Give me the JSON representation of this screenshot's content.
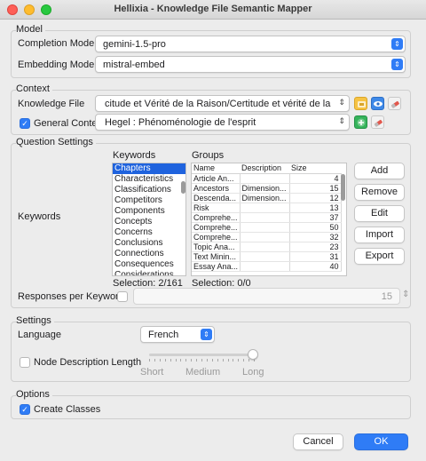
{
  "window": {
    "title": "Hellixia - Knowledge File Semantic Mapper"
  },
  "model": {
    "group_label": "Model",
    "completion_label": "Completion Model",
    "completion_value": "gemini-1.5-pro",
    "embedding_label": "Embedding Model",
    "embedding_value": "mistral-embed"
  },
  "context": {
    "group_label": "Context",
    "knowledge_file_label": "Knowledge File",
    "knowledge_file_value": "citude et Vérité de la Raison/Certitude et vérité de la raison",
    "general_context_label": "General Context",
    "general_context_checked": true,
    "general_context_value": "Hegel : Phénoménologie de l'esprit"
  },
  "question_settings": {
    "group_label": "Question Settings",
    "keywords_label": "Keywords",
    "keywords_header": "Keywords",
    "keywords": [
      "Chapters",
      "Characteristics",
      "Classifications",
      "Competitors",
      "Components",
      "Concepts",
      "Concerns",
      "Conclusions",
      "Connections",
      "Consequences",
      "Considerations"
    ],
    "keywords_selected_index": 0,
    "keywords_selection": "Selection: 2/161",
    "groups_header": "Groups",
    "groups_columns": [
      "Name",
      "Description",
      "Size"
    ],
    "groups_rows": [
      [
        "Article An...",
        "",
        "4"
      ],
      [
        "Ancestors",
        "Dimension...",
        "15"
      ],
      [
        "Descenda...",
        "Dimension...",
        "12"
      ],
      [
        "Risk",
        "",
        "13"
      ],
      [
        "Comprehe...",
        "",
        "37"
      ],
      [
        "Comprehe...",
        "",
        "50"
      ],
      [
        "Comprehe...",
        "",
        "32"
      ],
      [
        "Topic Ana...",
        "",
        "23"
      ],
      [
        "Text Minin...",
        "",
        "31"
      ],
      [
        "Essay Ana...",
        "",
        "40"
      ]
    ],
    "groups_selection": "Selection: 0/0",
    "buttons": {
      "add": "Add",
      "remove": "Remove",
      "edit": "Edit",
      "import": "Import",
      "export": "Export"
    },
    "responses_label": "Responses per Keyword",
    "responses_checked": false,
    "responses_value": "15"
  },
  "settings": {
    "group_label": "Settings",
    "language_label": "Language",
    "language_value": "French",
    "node_desc_label": "Node Description Length",
    "node_desc_checked": false,
    "slider_labels": [
      "Short",
      "Medium",
      "Long"
    ],
    "slider_value": "Long"
  },
  "options": {
    "group_label": "Options",
    "create_classes_label": "Create Classes",
    "create_classes_checked": true
  },
  "footer": {
    "cancel": "Cancel",
    "ok": "OK"
  },
  "colors": {
    "accent": "#2f7cf6",
    "selection": "#1f63de"
  }
}
